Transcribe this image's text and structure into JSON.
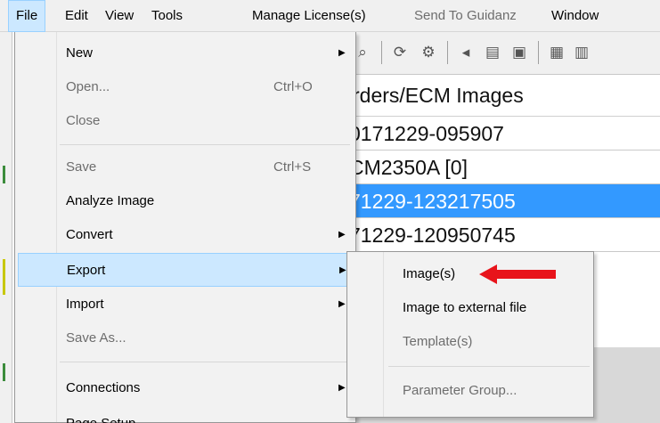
{
  "menubar": {
    "items": [
      {
        "label": "File"
      },
      {
        "label": "Edit"
      },
      {
        "label": "View"
      },
      {
        "label": "Tools"
      },
      {
        "label": "Manage License(s)"
      },
      {
        "label": "Send To Guidanz"
      },
      {
        "label": "Window"
      }
    ]
  },
  "file_menu": {
    "items": [
      {
        "label": "New"
      },
      {
        "label": "Open...",
        "shortcut": "Ctrl+O"
      },
      {
        "label": "Close"
      },
      {
        "label": "Save",
        "shortcut": "Ctrl+S"
      },
      {
        "label": "Analyze Image"
      },
      {
        "label": "Convert"
      },
      {
        "label": "Export"
      },
      {
        "label": "Import"
      },
      {
        "label": "Save As..."
      },
      {
        "label": "Connections"
      },
      {
        "label": "Page Setup"
      }
    ]
  },
  "export_submenu": {
    "items": [
      {
        "label": "Image(s)"
      },
      {
        "label": "Image to external file"
      },
      {
        "label": "Template(s)"
      },
      {
        "label": "Parameter Group..."
      }
    ]
  },
  "background_list": {
    "header": "rders/ECM Images",
    "rows": [
      {
        "text": "0171229-095907"
      },
      {
        "text": "CM2350A [0]"
      },
      {
        "text": "71229-123217505"
      },
      {
        "text": "71229-120950745"
      }
    ]
  },
  "colors": {
    "highlight": "#cce8ff",
    "selection": "#3399ff",
    "annotation_arrow": "#e8141b"
  }
}
